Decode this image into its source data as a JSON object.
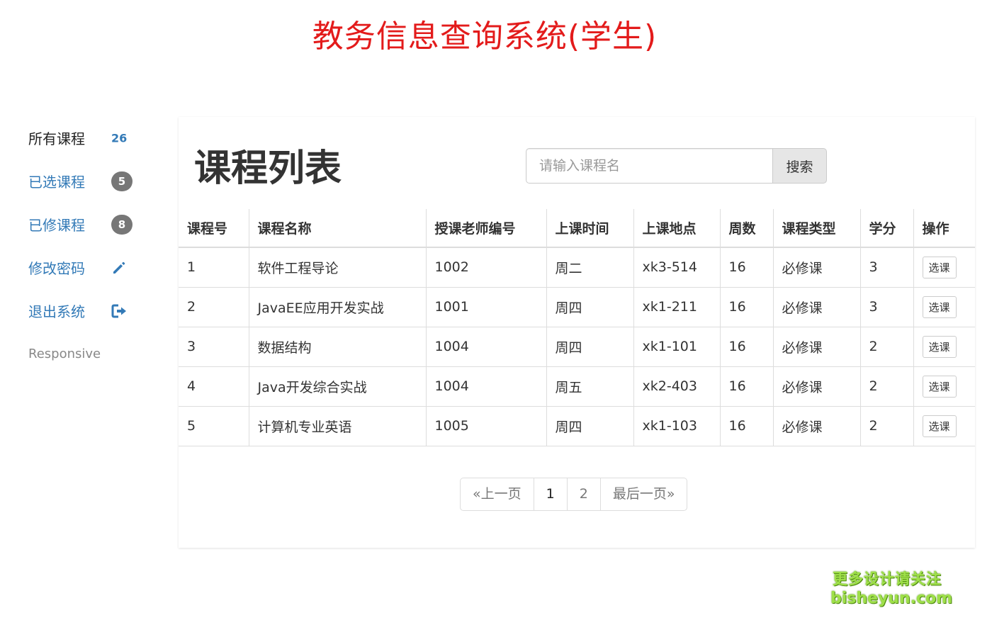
{
  "app": {
    "title": "教务信息查询系统(学生)"
  },
  "sidebar": {
    "items": [
      {
        "label": "所有课程",
        "count": "26",
        "active": true
      },
      {
        "label": "已选课程",
        "badge": "5"
      },
      {
        "label": "已修课程",
        "badge": "8"
      },
      {
        "label": "修改密码",
        "icon": "pencil-icon"
      },
      {
        "label": "退出系统",
        "icon": "logout-icon"
      },
      {
        "label": "Responsive"
      }
    ]
  },
  "main": {
    "heading": "课程列表",
    "search": {
      "placeholder": "请输入课程名",
      "button_label": "搜索"
    },
    "table": {
      "columns": [
        "课程号",
        "课程名称",
        "授课老师编号",
        "上课时间",
        "上课地点",
        "周数",
        "课程类型",
        "学分",
        "操作"
      ],
      "rows": [
        {
          "id": "1",
          "name": "软件工程导论",
          "teacher": "1002",
          "time": "周二",
          "place": "xk3-514",
          "weeks": "16",
          "type": "必修课",
          "credit": "3",
          "action": "选课"
        },
        {
          "id": "2",
          "name": "JavaEE应用开发实战",
          "teacher": "1001",
          "time": "周四",
          "place": "xk1-211",
          "weeks": "16",
          "type": "必修课",
          "credit": "3",
          "action": "选课"
        },
        {
          "id": "3",
          "name": "数据结构",
          "teacher": "1004",
          "time": "周四",
          "place": "xk1-101",
          "weeks": "16",
          "type": "必修课",
          "credit": "2",
          "action": "选课"
        },
        {
          "id": "4",
          "name": "Java开发综合实战",
          "teacher": "1004",
          "time": "周五",
          "place": "xk2-403",
          "weeks": "16",
          "type": "必修课",
          "credit": "2",
          "action": "选课"
        },
        {
          "id": "5",
          "name": "计算机专业英语",
          "teacher": "1005",
          "time": "周四",
          "place": "xk1-103",
          "weeks": "16",
          "type": "必修课",
          "credit": "2",
          "action": "选课"
        }
      ]
    },
    "pagination": {
      "prev": "«上一页",
      "pages": [
        "1",
        "2"
      ],
      "current": "1",
      "last": "最后一页»"
    }
  },
  "watermark": {
    "line1": "更多设计请关注",
    "line2": "bisheyun.com"
  },
  "colors": {
    "title": "#e31b1b",
    "link": "#337ab7",
    "badge": "#777777",
    "watermark": "#9fe04a"
  }
}
